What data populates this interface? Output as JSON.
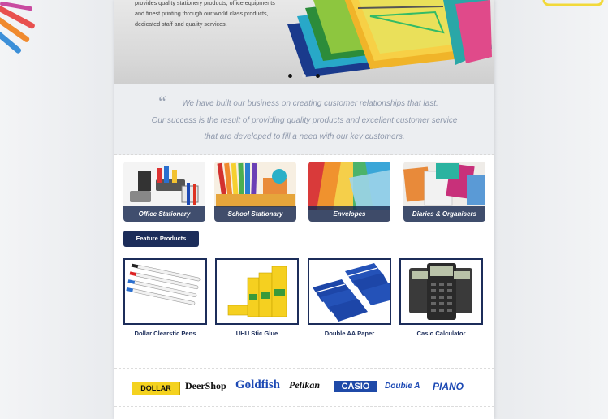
{
  "hero": {
    "text_lines": [
      "provides quality stationery products, office equipments",
      "and finest printing through our world class products,",
      "dedicated staff and quality services."
    ],
    "slides": 3,
    "active_slide": 1
  },
  "quote": {
    "mark": "“",
    "lines": [
      "We have built our business on creating customer relationships that last.",
      "Our success is the result of providing quality products and excellent customer service",
      "that are developed to fill a need with our key customers."
    ]
  },
  "categories": [
    {
      "label": "Office Stationary",
      "icon": "office-supplies-image"
    },
    {
      "label": "School Stationary",
      "icon": "colored-pencils-image"
    },
    {
      "label": "Envelopes",
      "icon": "envelopes-image"
    },
    {
      "label": "Diaries & Organisers",
      "icon": "diaries-image"
    }
  ],
  "featured_button": "Feature Products",
  "products": [
    {
      "name": "Dollar Clearstic Pens",
      "icon": "pens-image"
    },
    {
      "name": "UHU Stic Glue",
      "icon": "glue-sticks-image"
    },
    {
      "name": "Double AA Paper",
      "icon": "paper-reams-image"
    },
    {
      "name": "Casio Calculator",
      "icon": "calculators-image"
    }
  ],
  "brands": [
    "DOLLAR",
    "DeerShop",
    "Goldfish",
    "Pelikan",
    "CASIO",
    "Double A",
    "PIANO"
  ],
  "colors": {
    "navy": "#1c2d5a",
    "quote_text": "#8e98ab",
    "casio_blue": "#1f4aa8",
    "dollar_yellow": "#f4d21f"
  }
}
